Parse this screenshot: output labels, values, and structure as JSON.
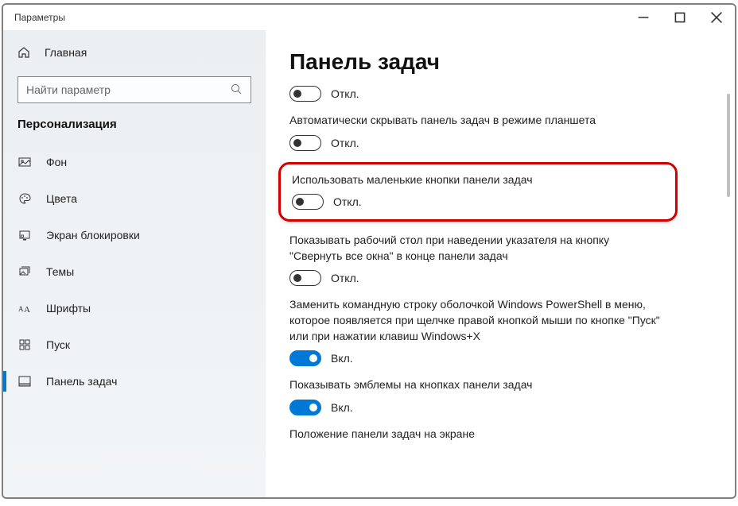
{
  "window": {
    "title": "Параметры"
  },
  "sidebar": {
    "home_label": "Главная",
    "search_placeholder": "Найти параметр",
    "section": "Персонализация",
    "items": [
      {
        "label": "Фон"
      },
      {
        "label": "Цвета"
      },
      {
        "label": "Экран блокировки"
      },
      {
        "label": "Темы"
      },
      {
        "label": "Шрифты"
      },
      {
        "label": "Пуск"
      },
      {
        "label": "Панель задач"
      }
    ]
  },
  "page": {
    "title": "Панель задач",
    "states": {
      "off": "Откл.",
      "on": "Вкл."
    },
    "settings": [
      {
        "label": "",
        "on": false
      },
      {
        "label": "Автоматически скрывать панель задач в режиме планшета",
        "on": false
      },
      {
        "label": "Использовать маленькие кнопки панели задач",
        "on": false,
        "highlighted": true
      },
      {
        "label": "Показывать рабочий стол при наведении указателя на кнопку \"Свернуть все окна\" в конце панели задач",
        "on": false
      },
      {
        "label": "Заменить командную строку оболочкой Windows PowerShell в меню, которое появляется при щелчке правой кнопкой мыши по кнопке \"Пуск\" или при нажатии клавиш Windows+X",
        "on": true
      },
      {
        "label": "Показывать эмблемы на кнопках панели задач",
        "on": true
      }
    ],
    "footer_label": "Положение панели задач на экране"
  }
}
